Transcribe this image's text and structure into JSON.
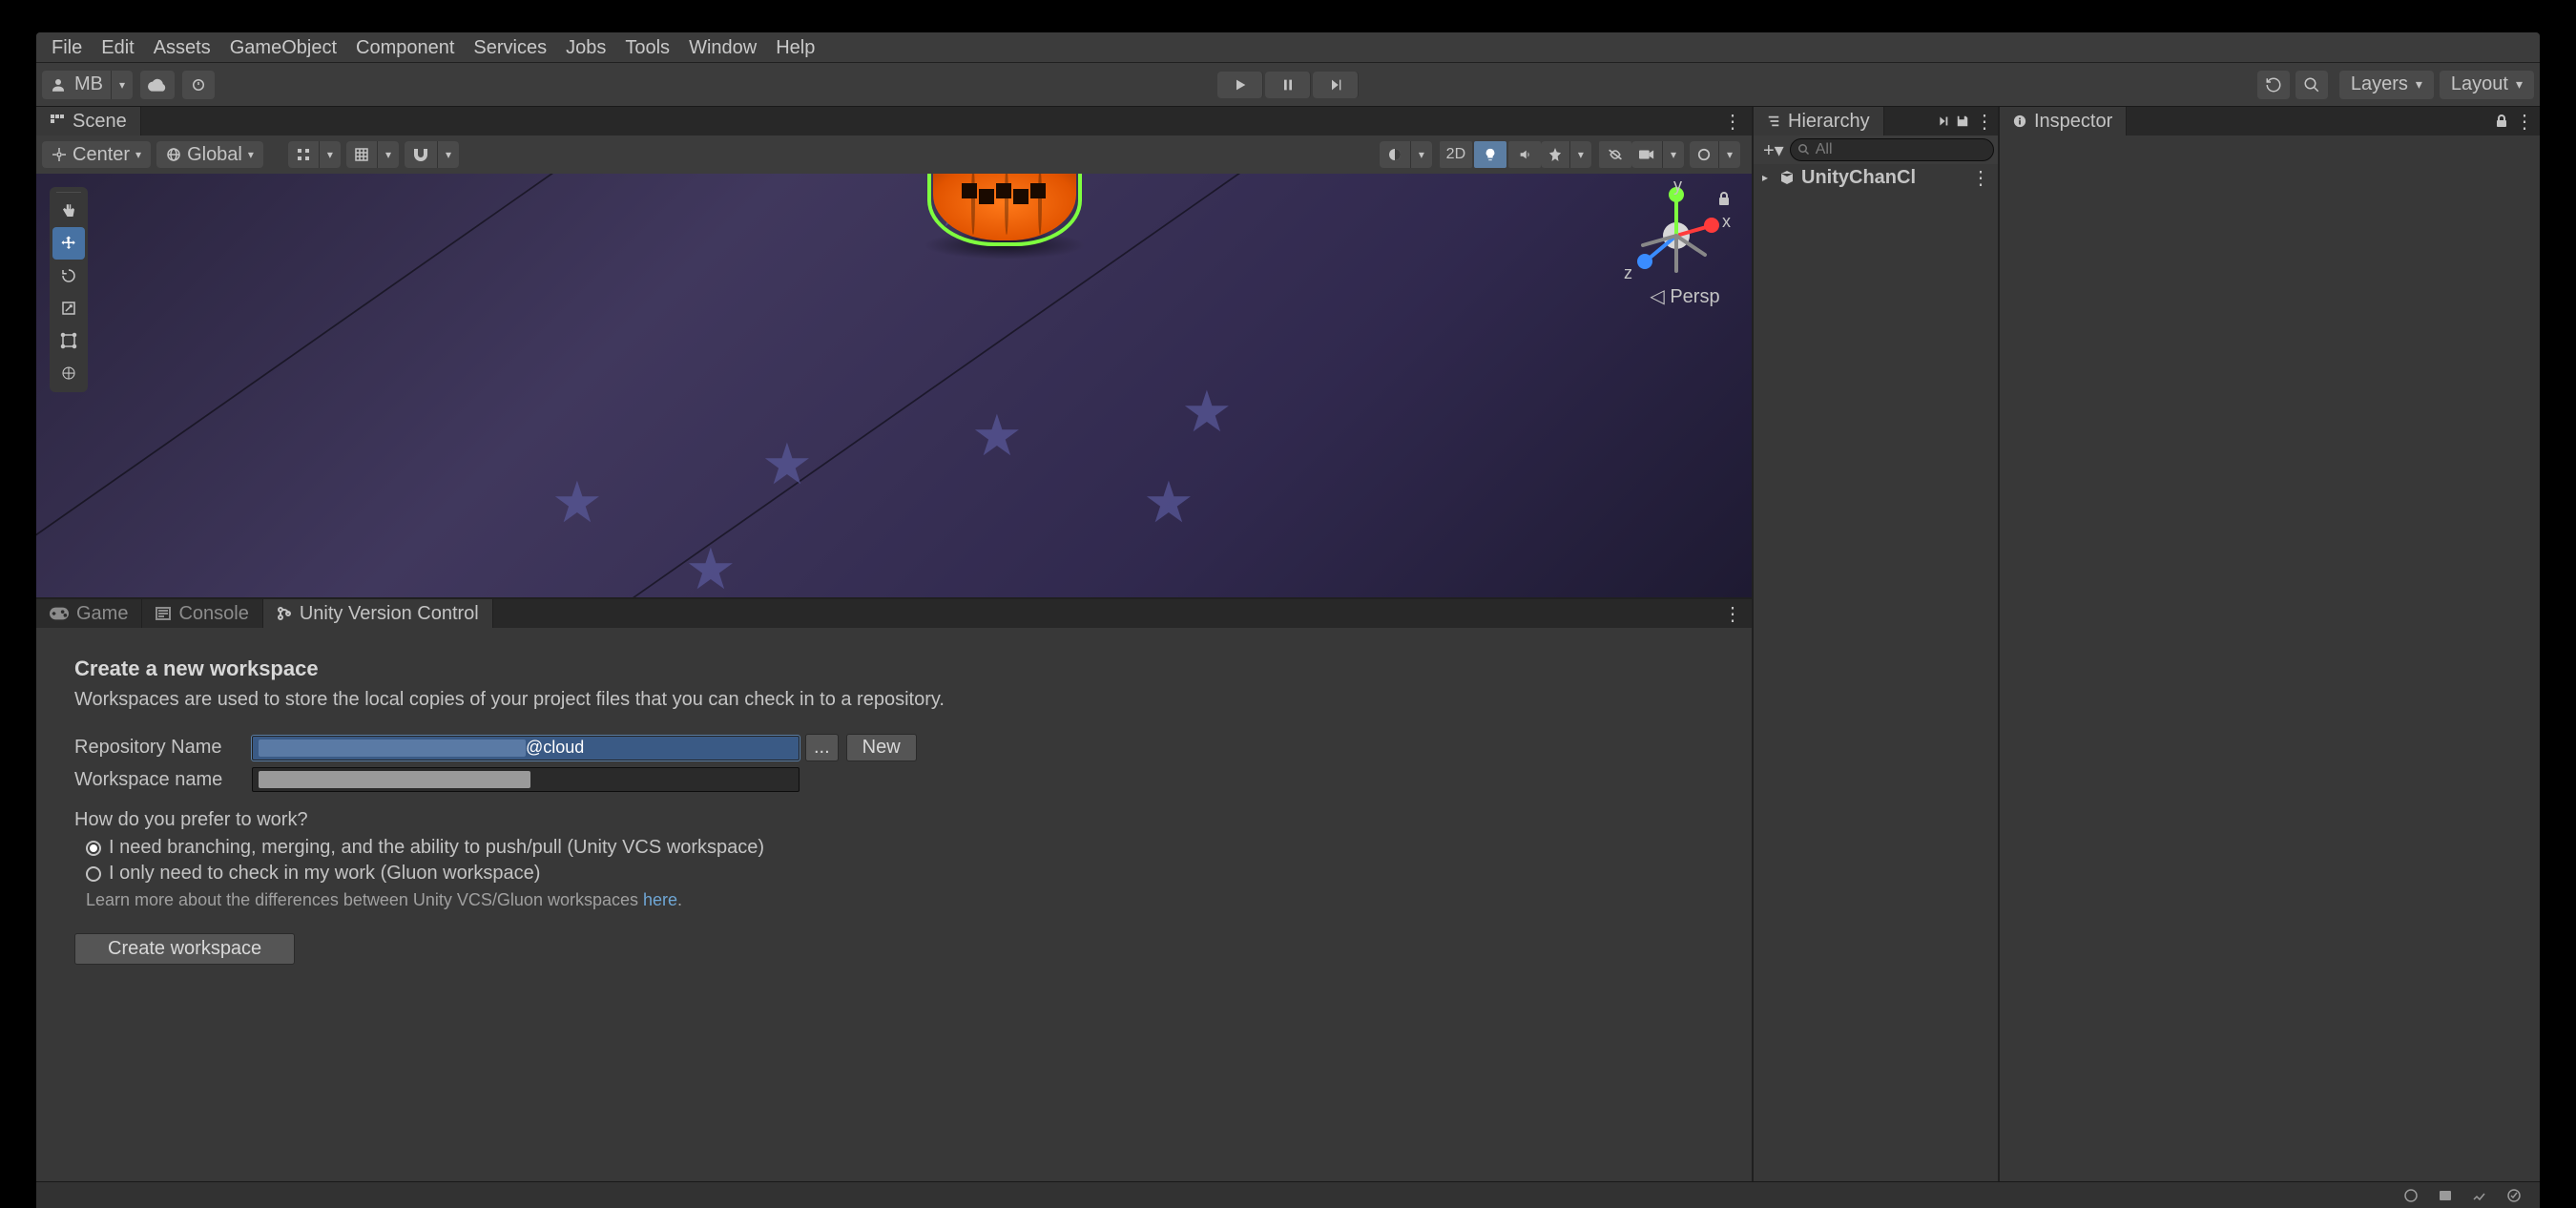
{
  "menu": {
    "items": [
      "File",
      "Edit",
      "Assets",
      "GameObject",
      "Component",
      "Services",
      "Jobs",
      "Tools",
      "Window",
      "Help"
    ]
  },
  "toolbar": {
    "account_label": "MB",
    "layers_label": "Layers",
    "layout_label": "Layout"
  },
  "scene": {
    "tab_label": "Scene",
    "pivot_label": "Center",
    "space_label": "Global",
    "twod_label": "2D",
    "persp_label": "Persp",
    "axes": {
      "x": "x",
      "y": "y",
      "z": "z"
    }
  },
  "hierarchy": {
    "tab_label": "Hierarchy",
    "search_placeholder": "All",
    "root_item": "UnityChanCl"
  },
  "inspector": {
    "tab_label": "Inspector"
  },
  "bottom": {
    "game_tab": "Game",
    "console_tab": "Console",
    "vcs_tab": "Unity Version Control"
  },
  "vcs": {
    "title": "Create a new workspace",
    "subtitle": "Workspaces are used to store the local copies of your project files that you can check in to a repository.",
    "repo_label": "Repository Name",
    "repo_value_suffix": "@cloud",
    "browse_btn": "...",
    "new_btn": "New",
    "ws_label": "Workspace name",
    "question": "How do you prefer to work?",
    "opt_branch": "I need branching, merging, and the ability to push/pull (Unity VCS workspace)",
    "opt_gluon": "I only need to check in my work (Gluon workspace)",
    "learn_prefix": "Learn more about the differences between Unity VCS/Gluon workspaces ",
    "learn_link": "here",
    "learn_suffix": ".",
    "create_btn": "Create workspace"
  }
}
